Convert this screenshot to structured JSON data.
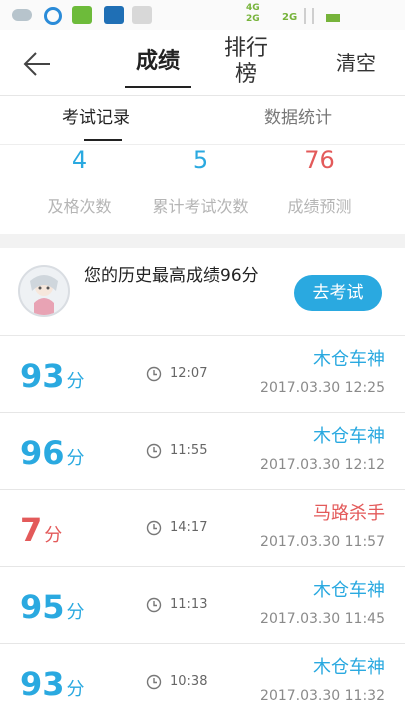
{
  "status_bar": {
    "network": [
      "4G",
      "2G"
    ],
    "network2": "2G"
  },
  "header": {
    "tab_score": "成绩",
    "tab_rank": "排行榜",
    "clear": "清空"
  },
  "subtabs": {
    "records": "考试记录",
    "stats": "数据统计"
  },
  "stats": [
    {
      "value": "4",
      "label": "及格次数",
      "color": "#2aa9e0"
    },
    {
      "value": "5",
      "label": "累计考试次数",
      "color": "#2aa9e0"
    },
    {
      "value": "76",
      "label": "成绩预测",
      "color": "#e35a5a"
    }
  ],
  "history": {
    "text": "您的历史最高成绩96分",
    "button": "去考试"
  },
  "records": [
    {
      "score": "93",
      "unit": "分",
      "duration": "12:07",
      "title": "木仓车神",
      "date": "2017.03.30  12:25",
      "color": "#2aa9e0"
    },
    {
      "score": "96",
      "unit": "分",
      "duration": "11:55",
      "title": "木仓车神",
      "date": "2017.03.30  12:12",
      "color": "#2aa9e0"
    },
    {
      "score": "7",
      "unit": "分",
      "duration": "14:17",
      "title": "马路杀手",
      "date": "2017.03.30  11:57",
      "color": "#e35a5a"
    },
    {
      "score": "95",
      "unit": "分",
      "duration": "11:13",
      "title": "木仓车神",
      "date": "2017.03.30  11:45",
      "color": "#2aa9e0"
    },
    {
      "score": "93",
      "unit": "分",
      "duration": "10:38",
      "title": "木仓车神",
      "date": "2017.03.30  11:32",
      "color": "#2aa9e0"
    }
  ]
}
